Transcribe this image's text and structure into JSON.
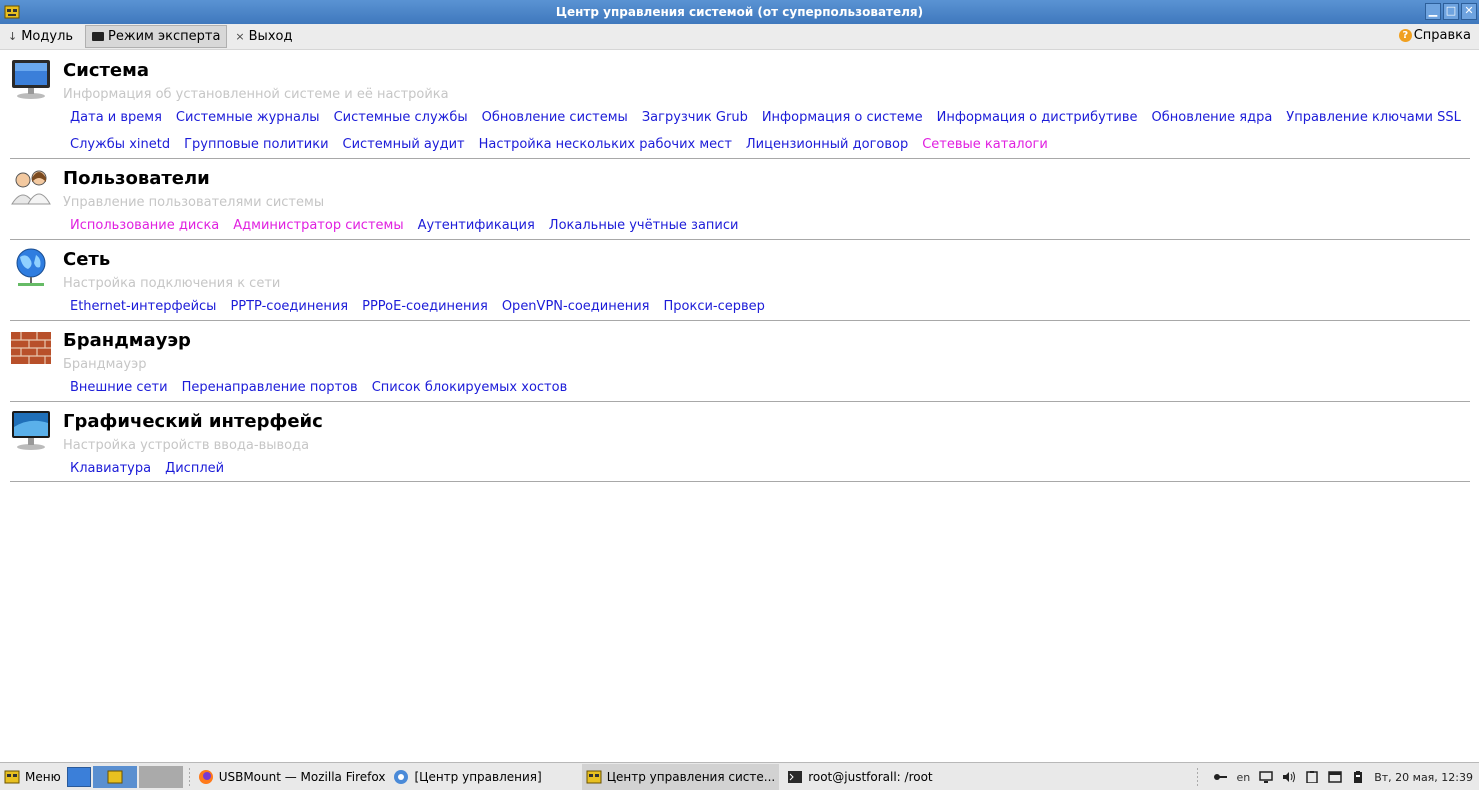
{
  "window": {
    "title": "Центр управления системой (от суперпользователя)",
    "controls": [
      "minimize",
      "maximize",
      "close"
    ]
  },
  "toolbar": {
    "module_label": "Модуль",
    "expert_label": "Режим эксперта",
    "exit_label": "Выход",
    "help_label": "Справка"
  },
  "sections": [
    {
      "title": "Система",
      "desc": "Информация об установленной системе и её настройка",
      "icon": "monitor-icon",
      "rows": [
        [
          {
            "label": "Дата и время"
          },
          {
            "label": "Системные журналы"
          },
          {
            "label": "Системные службы"
          },
          {
            "label": "Обновление системы"
          },
          {
            "label": "Загрузчик Grub"
          },
          {
            "label": "Информация о системе"
          },
          {
            "label": "Информация о дистрибутиве"
          },
          {
            "label": "Обновление ядра"
          },
          {
            "label": "Управление ключами SSL"
          }
        ],
        [
          {
            "label": "Службы xinetd"
          },
          {
            "label": "Групповые политики"
          },
          {
            "label": "Системный аудит"
          },
          {
            "label": "Настройка нескольких рабочих мест"
          },
          {
            "label": "Лицензионный договор"
          },
          {
            "label": "Сетевые каталоги",
            "visited": true
          }
        ]
      ]
    },
    {
      "title": "Пользователи",
      "desc": "Управление пользователями системы",
      "icon": "users-icon",
      "rows": [
        [
          {
            "label": "Использование диска",
            "visited": true
          },
          {
            "label": "Администратор системы",
            "visited": true
          },
          {
            "label": "Аутентификация"
          },
          {
            "label": "Локальные учётные записи"
          }
        ]
      ]
    },
    {
      "title": "Сеть",
      "desc": "Настройка подключения к сети",
      "icon": "globe-network-icon",
      "rows": [
        [
          {
            "label": "Ethernet-интерфейсы"
          },
          {
            "label": "PPTP-соединения"
          },
          {
            "label": "PPPoE-соединения"
          },
          {
            "label": "OpenVPN-соединения"
          },
          {
            "label": "Прокси-сервер"
          }
        ]
      ]
    },
    {
      "title": "Брандмауэр",
      "desc": "Брандмауэр",
      "icon": "brick-wall-icon",
      "rows": [
        [
          {
            "label": "Внешние сети"
          },
          {
            "label": "Перенаправление портов"
          },
          {
            "label": "Список блокируемых хостов"
          }
        ]
      ]
    },
    {
      "title": "Графический интерфейс",
      "desc": "Настройка устройств ввода-вывода",
      "icon": "display-icon",
      "rows": [
        [
          {
            "label": "Клавиатура"
          },
          {
            "label": "Дисплей"
          }
        ]
      ]
    }
  ],
  "taskbar": {
    "menu_label": "Меню",
    "tasks": [
      {
        "label": "USBMount — Mozilla Firefox",
        "icon": "firefox-icon"
      },
      {
        "label": "[Центр управления]",
        "icon": "gear-icon"
      },
      {
        "label": "Центр управления систе...",
        "icon": "control-center-icon",
        "active": true
      },
      {
        "label": "root@justforall: /root",
        "icon": "terminal-icon"
      }
    ],
    "lang": "en",
    "clock": "Вт, 20 мая, 12:39"
  },
  "colors": {
    "link": "#1c1cd8",
    "visited_link": "#e020e0",
    "desc": "#c6c6c6",
    "titlebar": "#4a85c8"
  }
}
